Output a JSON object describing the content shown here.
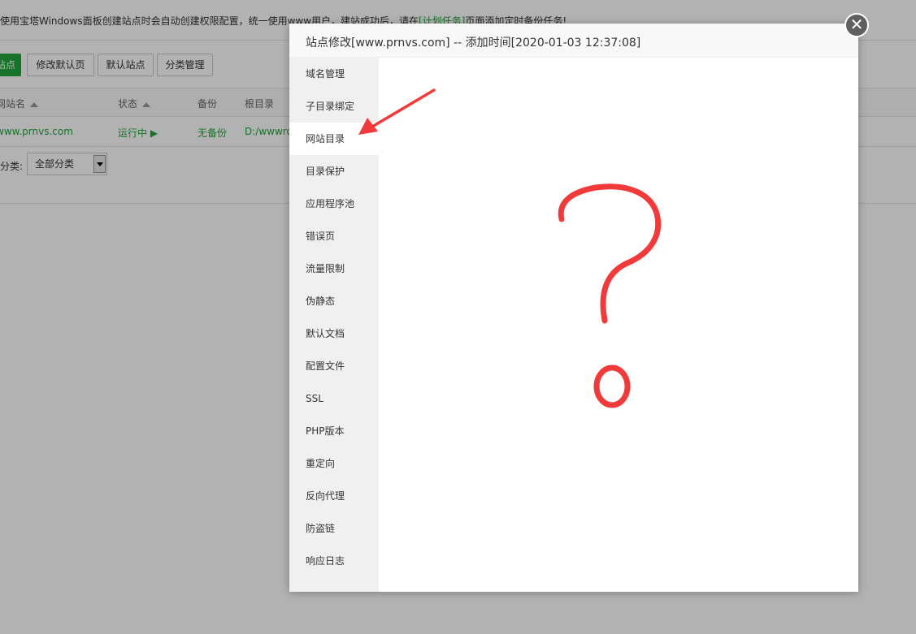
{
  "page": {
    "notice": {
      "prefix": "使用宝塔Windows面板创建站点时会自动创建权限配置，统一使用www用户，建站成功后，请在",
      "link": "[计划任务]",
      "suffix": "页面添加定时备份任务!"
    },
    "toolbar": {
      "add_site": "站点",
      "edit_default_page": "修改默认页",
      "default_site": "默认站点",
      "category_manage": "分类管理"
    },
    "table": {
      "headers": [
        "网站名",
        "状态",
        "备份",
        "根目录"
      ],
      "rows": [
        {
          "name": "www.prnvs.com",
          "status": "运行中 ▶",
          "backup": "无备份",
          "root": "D:/wwwro"
        }
      ]
    },
    "filter": {
      "label": "分类:",
      "selected": "全部分类"
    }
  },
  "dialog": {
    "title": "站点修改[www.prnvs.com] -- 添加时间[2020-01-03 12:37:08]",
    "close_glyph": "✕",
    "menu": [
      {
        "label": "域名管理",
        "active": false
      },
      {
        "label": "子目录绑定",
        "active": false
      },
      {
        "label": "网站目录",
        "active": true
      },
      {
        "label": "目录保护",
        "active": false
      },
      {
        "label": "应用程序池",
        "active": false
      },
      {
        "label": "错误页",
        "active": false
      },
      {
        "label": "流量限制",
        "active": false
      },
      {
        "label": "伪静态",
        "active": false
      },
      {
        "label": "默认文档",
        "active": false
      },
      {
        "label": "配置文件",
        "active": false
      },
      {
        "label": "SSL",
        "active": false
      },
      {
        "label": "PHP版本",
        "active": false
      },
      {
        "label": "重定向",
        "active": false
      },
      {
        "label": "反向代理",
        "active": false
      },
      {
        "label": "防盗链",
        "active": false
      },
      {
        "label": "响应日志",
        "active": false
      }
    ]
  },
  "annotations": {
    "arrow_color": "#f23a3a",
    "question_mark_color": "#f23a3a"
  }
}
